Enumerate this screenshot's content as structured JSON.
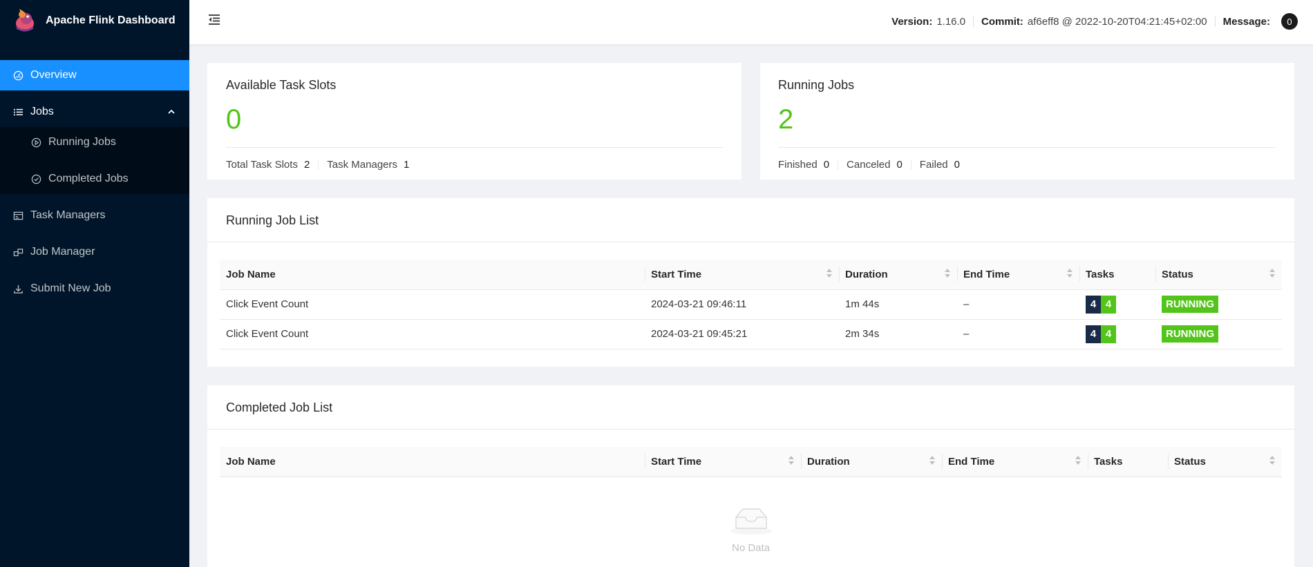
{
  "app": {
    "title": "Apache Flink Dashboard"
  },
  "sidebar": {
    "items": [
      {
        "label": "Overview",
        "icon": "dashboard-icon"
      },
      {
        "label": "Jobs",
        "icon": "list-icon"
      },
      {
        "label": "Running Jobs",
        "icon": "play-circle-icon"
      },
      {
        "label": "Completed Jobs",
        "icon": "check-circle-icon"
      },
      {
        "label": "Task Managers",
        "icon": "schedule-icon"
      },
      {
        "label": "Job Manager",
        "icon": "build-icon"
      },
      {
        "label": "Submit New Job",
        "icon": "upload-icon"
      }
    ]
  },
  "header": {
    "version_label": "Version:",
    "version": "1.16.0",
    "commit_label": "Commit:",
    "commit": "af6eff8 @ 2022-10-20T04:21:45+02:00",
    "message_label": "Message:",
    "message_count": "0"
  },
  "slots_card": {
    "title": "Available Task Slots",
    "value": "0",
    "total_label": "Total Task Slots",
    "total": "2",
    "tm_label": "Task Managers",
    "tm": "1"
  },
  "jobs_card": {
    "title": "Running Jobs",
    "value": "2",
    "finished_label": "Finished",
    "finished": "0",
    "canceled_label": "Canceled",
    "canceled": "0",
    "failed_label": "Failed",
    "failed": "0"
  },
  "running_list": {
    "title": "Running Job List",
    "columns": [
      "Job Name",
      "Start Time",
      "Duration",
      "End Time",
      "Tasks",
      "Status"
    ],
    "rows": [
      {
        "name": "Click Event Count",
        "start": "2024-03-21 09:46:11",
        "duration": "1m 44s",
        "end": "–",
        "tasks_a": "4",
        "tasks_b": "4",
        "status": "RUNNING"
      },
      {
        "name": "Click Event Count",
        "start": "2024-03-21 09:45:21",
        "duration": "2m 34s",
        "end": "–",
        "tasks_a": "4",
        "tasks_b": "4",
        "status": "RUNNING"
      }
    ]
  },
  "completed_list": {
    "title": "Completed Job List",
    "columns": [
      "Job Name",
      "Start Time",
      "Duration",
      "End Time",
      "Tasks",
      "Status"
    ],
    "empty_text": "No Data"
  },
  "colors": {
    "sidebar_bg": "#001529",
    "active": "#1890ff",
    "success": "#52c41a",
    "task_dark": "#1a2b4a"
  }
}
